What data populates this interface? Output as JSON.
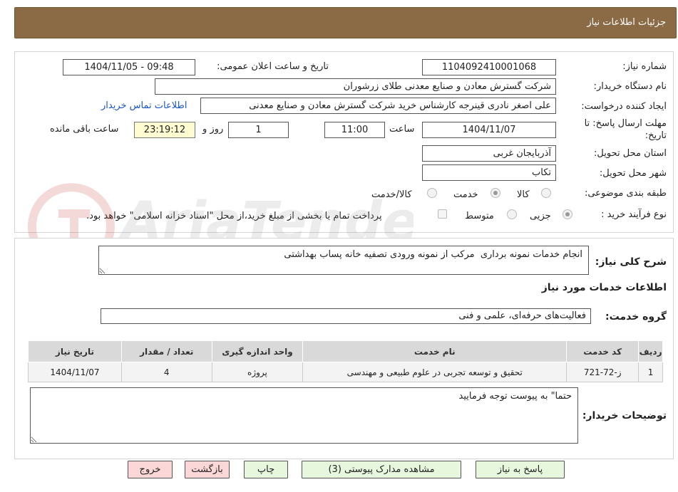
{
  "header": {
    "title": "جزئیات اطلاعات نیاز"
  },
  "fields": {
    "need_number_label": "شماره نیاز:",
    "need_number": "1104092410001068",
    "announce_label": "تاریخ و ساعت اعلان عمومی:",
    "announce_value": "1404/11/05 - 09:48",
    "buyer_org_label": "نام دستگاه خریدار:",
    "buyer_org": "شرکت گسترش معادن و صنایع معدنی طلای زرشوران",
    "requester_label": "ایجاد کننده درخواست:",
    "requester": "علی اصغر نادری قینرجه کارشناس خرید  شرکت گسترش معادن و صنایع معدنی",
    "contact_link": "اطلاعات تماس خریدار",
    "deadline_label_1": "مهلت ارسال پاسخ: تا",
    "deadline_label_2": "تاریخ:",
    "deadline_date": "1404/11/07",
    "time_label": "ساعت",
    "deadline_time": "11:00",
    "days_value": "1",
    "days_label": "روز و",
    "remaining_time": "23:19:12",
    "remaining_label": "ساعت باقی مانده",
    "province_label": "استان محل تحویل:",
    "province": "آذربایجان غربی",
    "city_label": "شهر محل تحویل:",
    "city": "تکاب",
    "category_label": "طبقه بندی موضوعی:",
    "category_options": [
      "کالا",
      "خدمت",
      "کالا/خدمت"
    ],
    "category_selected": "خدمت",
    "process_label": "نوع فرآیند خرید :",
    "process_options": [
      "جزیی",
      "متوسط"
    ],
    "process_selected": "جزیی",
    "payment_note": "پرداخت تمام یا بخشی از مبلغ خرید،از محل \"اسناد خزانه اسلامی\" خواهد بود."
  },
  "description": {
    "label": "شرح کلی نیاز:",
    "value": "انجام خدمات نمونه برداری  مرکب از نمونه ورودی تصفیه خانه پساب بهداشتی"
  },
  "services": {
    "section_title": "اطلاعات خدمات مورد نیاز",
    "group_label": "گروه خدمت:",
    "group_value": "فعالیت‌های حرفه‌ای، علمی و فنی",
    "columns": [
      "ردیف",
      "کد خدمت",
      "نام خدمت",
      "واحد اندازه گیری",
      "تعداد / مقدار",
      "تاریخ نیاز"
    ],
    "rows": [
      [
        "1",
        "ز-72-721",
        "تحقیق و توسعه تجربی در علوم طبیعی و مهندسی",
        "پروژه",
        "4",
        "1404/11/07"
      ]
    ]
  },
  "buyer_notes": {
    "label": "توضیحات خریدار:",
    "value": "حتما\" به پیوست توجه فرمایید"
  },
  "buttons": {
    "reply": "پاسخ به نیاز",
    "attachments": "مشاهده مدارک پیوستی (3)",
    "print": "چاپ",
    "back": "بازگشت",
    "exit": "خروج"
  },
  "watermark": {
    "text": "AriaTender.neT"
  },
  "colors": {
    "header_bg": "#8b6b45",
    "button_green": "#e6f7de",
    "button_pink": "#fbd7d7",
    "link_blue": "#1a55c8",
    "remaining_bg": "#fefcd0"
  }
}
